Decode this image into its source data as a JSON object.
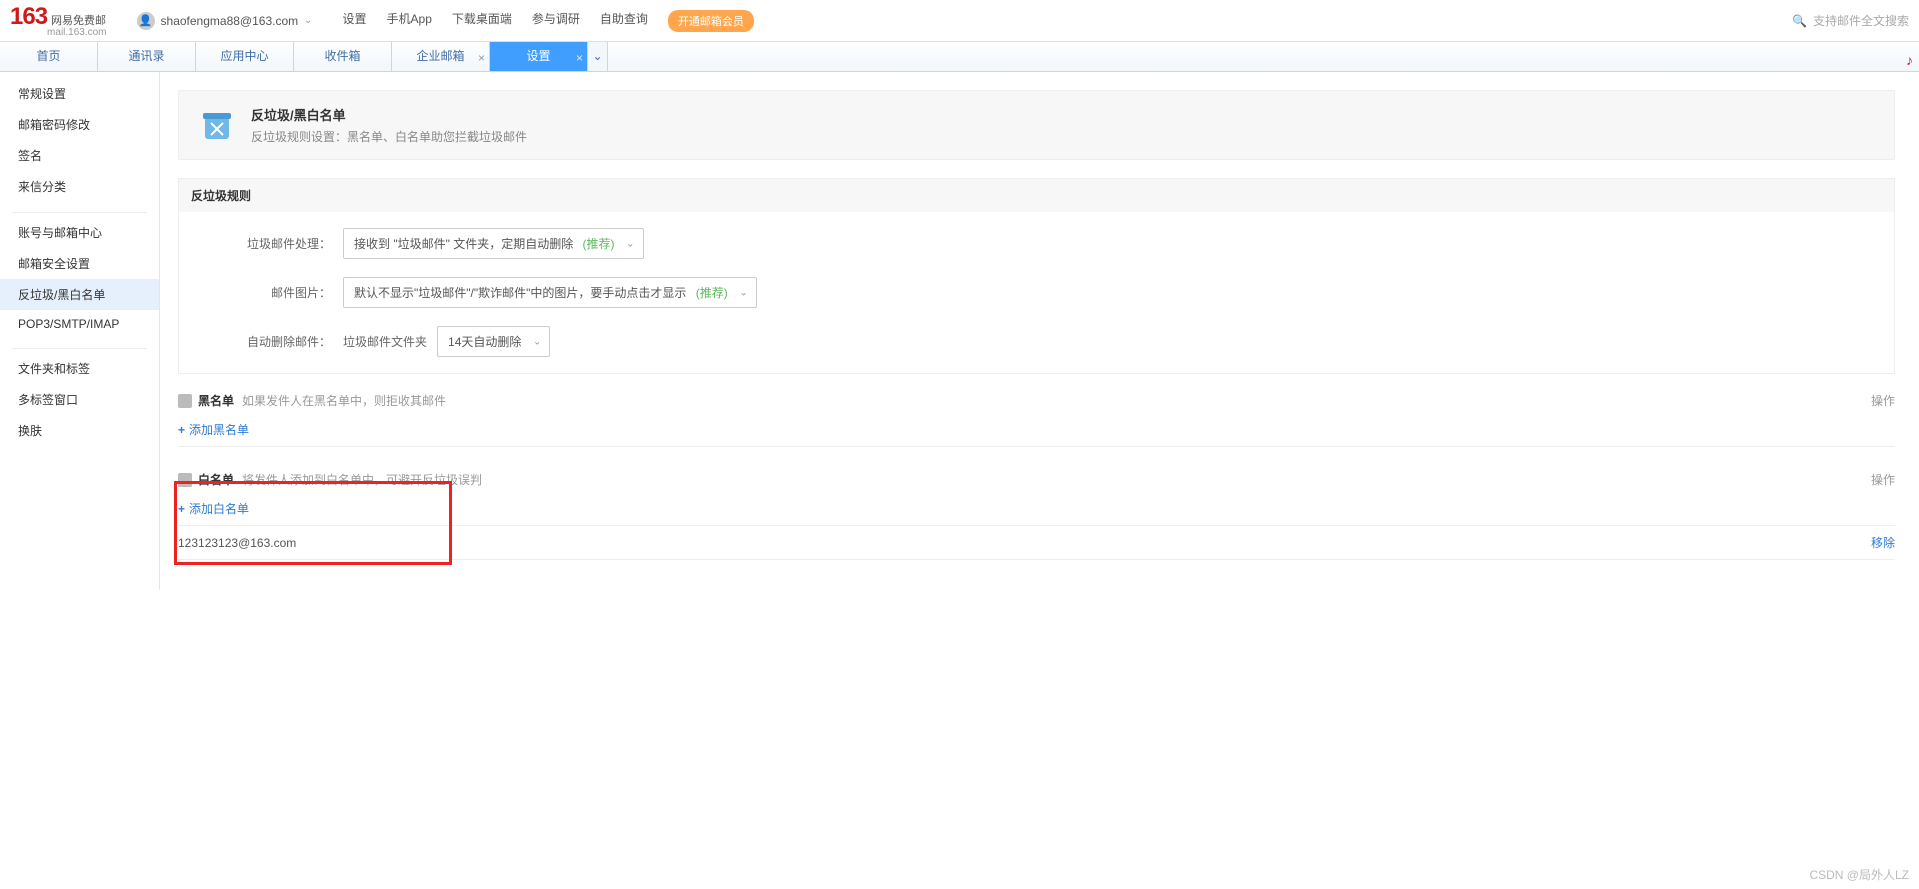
{
  "header": {
    "logo_main": "163",
    "logo_sub": "网易免费邮",
    "logo_domain": "mail.163.com",
    "user_email": "shaofengma88@163.com",
    "topnav": [
      "设置",
      "手机App",
      "下载桌面端",
      "参与调研",
      "自助查询"
    ],
    "vip_label": "开通邮箱会员",
    "search_placeholder": "支持邮件全文搜索"
  },
  "tabs": [
    {
      "label": "首页",
      "active": false,
      "closable": false
    },
    {
      "label": "通讯录",
      "active": false,
      "closable": false
    },
    {
      "label": "应用中心",
      "active": false,
      "closable": false
    },
    {
      "label": "收件箱",
      "active": false,
      "closable": false
    },
    {
      "label": "企业邮箱",
      "active": false,
      "closable": true
    },
    {
      "label": "设置",
      "active": true,
      "closable": true
    }
  ],
  "sidebar": {
    "group1": [
      "常规设置",
      "邮箱密码修改",
      "签名",
      "来信分类"
    ],
    "group2": [
      "账号与邮箱中心",
      "邮箱安全设置",
      "反垃圾/黑白名单",
      "POP3/SMTP/IMAP"
    ],
    "group3": [
      "文件夹和标签",
      "多标签窗口",
      "换肤"
    ],
    "active": "反垃圾/黑白名单"
  },
  "banner": {
    "title": "反垃圾/黑白名单",
    "desc": "反垃圾规则设置：黑名单、白名单助您拦截垃圾邮件"
  },
  "rules_section": {
    "title": "反垃圾规则",
    "fields": {
      "spam_handle": {
        "label": "垃圾邮件处理：",
        "value": "接收到 \"垃圾邮件\" 文件夹，定期自动删除",
        "reco": "(推荐)"
      },
      "mail_image": {
        "label": "邮件图片：",
        "value": "默认不显示\"垃圾邮件\"/\"欺诈邮件\"中的图片，要手动点击才显示",
        "reco": "(推荐)"
      },
      "auto_delete": {
        "label": "自动删除邮件：",
        "folder": "垃圾邮件文件夹",
        "period": "14天自动删除"
      }
    }
  },
  "blacklist": {
    "title": "黑名单",
    "hint": "如果发件人在黑名单中，则拒收其邮件",
    "ops_label": "操作",
    "add_label": "添加黑名单"
  },
  "whitelist": {
    "title": "白名单",
    "hint": "将发件人添加到白名单中，可避开反垃圾误判",
    "ops_label": "操作",
    "add_label": "添加白名单",
    "entries": [
      {
        "email": "123123123@163.com",
        "remove": "移除"
      }
    ]
  },
  "watermark": "CSDN @局外人LZ"
}
